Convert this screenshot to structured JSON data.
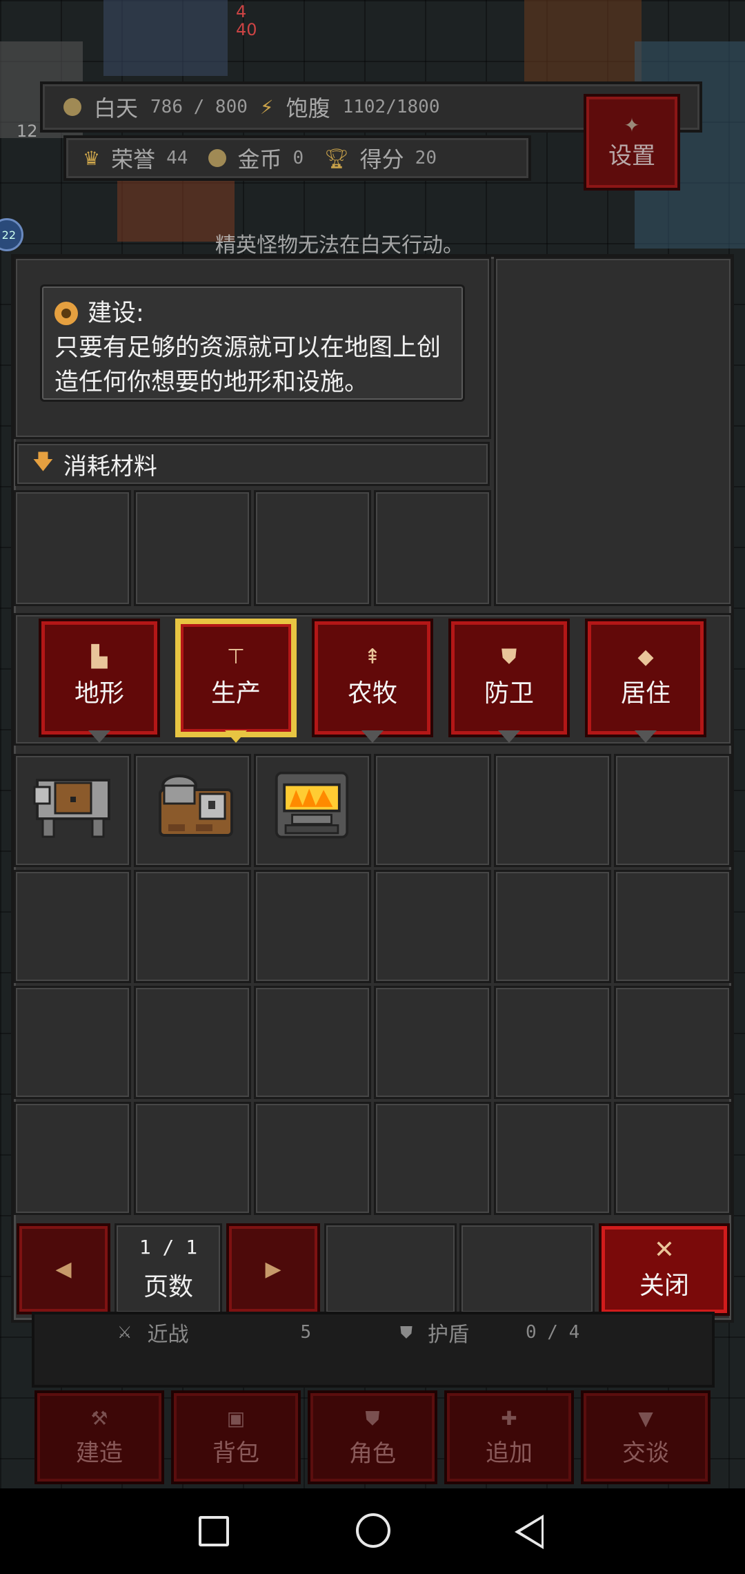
{
  "hud": {
    "day_label": "白天",
    "day_value": "786 / 800",
    "satiety_label": "饱腹",
    "satiety_value": "1102/1800",
    "honor_label": "荣誉",
    "honor_value": "44",
    "gold_label": "金币",
    "gold_value": "0",
    "score_label": "得分",
    "score_value": "20",
    "settings_label": "设置",
    "hint": "精英怪物无法在白天行动。",
    "player_stat_top": "4",
    "player_stat_bottom": "40",
    "badge_left": "12",
    "badge_num": "22"
  },
  "description": {
    "title": "建设:",
    "line1": "只要有足够的资源就可以在地图上创",
    "line2": "造任何你想要的地形和设施。"
  },
  "materials_header": "消耗材料",
  "tabs": [
    {
      "label": "地形",
      "icon": "terrain-icon",
      "active": false
    },
    {
      "label": "生产",
      "icon": "anvil-icon",
      "active": true
    },
    {
      "label": "农牧",
      "icon": "tree-icon",
      "active": false
    },
    {
      "label": "防卫",
      "icon": "shield-icon",
      "active": false
    },
    {
      "label": "居住",
      "icon": "house-icon",
      "active": false
    }
  ],
  "items": [
    {
      "name": "workbench",
      "icon": "workbench-icon"
    },
    {
      "name": "cooking-station",
      "icon": "cooking-station-icon"
    },
    {
      "name": "furnace",
      "icon": "furnace-icon"
    }
  ],
  "pagination": {
    "page": "1 / 1",
    "label": "页数"
  },
  "close_label": "关闭",
  "under": {
    "melee_label": "近战",
    "melee_value": "5",
    "shield_label": "护盾",
    "shield_value": "0 / 4"
  },
  "toolbar": [
    {
      "label": "建造",
      "icon": "hammer-icon"
    },
    {
      "label": "背包",
      "icon": "bag-icon"
    },
    {
      "label": "角色",
      "icon": "character-icon"
    },
    {
      "label": "追加",
      "icon": "plus-icon"
    },
    {
      "label": "交谈",
      "icon": "speech-icon"
    }
  ],
  "colors": {
    "tab_red": "#620909",
    "tab_border_red": "#b31717",
    "active_gold": "#e8c542",
    "panel_gray": "#2f2f2f",
    "accent_orange": "#e5a040"
  }
}
